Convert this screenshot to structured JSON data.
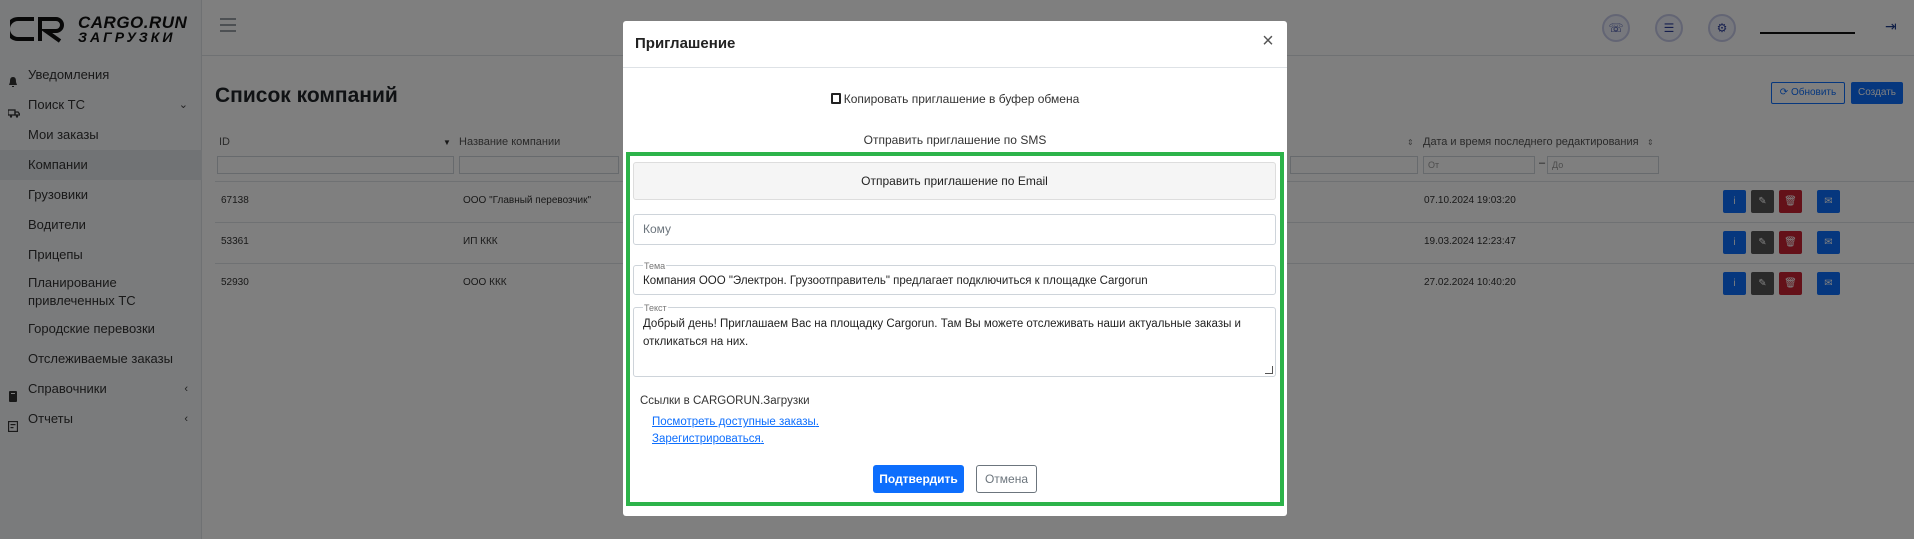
{
  "logo": {
    "line1": "CARGO.RUN",
    "line2": "ЗАГРУЗКИ"
  },
  "sidebar": {
    "items": [
      {
        "label": "Уведомления",
        "icon": "bell-icon"
      },
      {
        "label": "Поиск ТС",
        "icon": "truck-icon",
        "chevron": "⌄"
      },
      {
        "label": "Мои заказы"
      },
      {
        "label": "Компании"
      },
      {
        "label": "Грузовики"
      },
      {
        "label": "Водители"
      },
      {
        "label": "Прицепы"
      },
      {
        "label": "Планирование привлеченных ТС"
      },
      {
        "label": "Городские перевозки"
      },
      {
        "label": "Отслеживаемые заказы"
      },
      {
        "label": "Справочники",
        "icon": "book-icon",
        "chevron": "‹"
      },
      {
        "label": "Отчеты",
        "icon": "report-icon",
        "chevron": "‹"
      }
    ]
  },
  "page": {
    "title": "Список компаний",
    "refresh_label": "Обновить",
    "create_label": "Создать",
    "columns": {
      "id": "ID",
      "name": "Название компании",
      "edited": "Дата и время последнего редактирования"
    },
    "filter_from": "От",
    "filter_to": "До",
    "rows": [
      {
        "id": "67138",
        "name": "ООО \"Главный перевозчик\"",
        "edited": "07.10.2024 19:03:20"
      },
      {
        "id": "53361",
        "name": "ИП ККК",
        "edited": "19.03.2024 12:23:47"
      },
      {
        "id": "52930",
        "name": "ООО ККК",
        "edited": "27.02.2024 10:40:20"
      }
    ]
  },
  "modal": {
    "title": "Приглашение",
    "close": "×",
    "copy_label": "Копировать приглашение в буфер обмена",
    "sms_label": "Отправить приглашение по SMS",
    "email_label": "Отправить приглашение по Email",
    "to_placeholder": "Кому",
    "subject_label": "Тема",
    "subject_value": "Компания ООО \"Электрон. Грузоотправитель\" предлагает подключиться к площадке Cargorun",
    "body_label": "Текст",
    "body_value": "Добрый день! Приглашаем Вас на площадку Cargorun. Там Вы можете отслеживать наши актуальные заказы и откликаться на них.",
    "links_title": "Ссылки в CARGORUN.Загрузки",
    "link1": "Посмотреть доступные заказы",
    "link2": "Зарегистрироваться",
    "confirm_label": "Подтвердить",
    "cancel_label": "Отмена"
  },
  "colors": {
    "primary": "#0d6efd",
    "danger": "#c82333",
    "highlight": "#2db34a"
  }
}
